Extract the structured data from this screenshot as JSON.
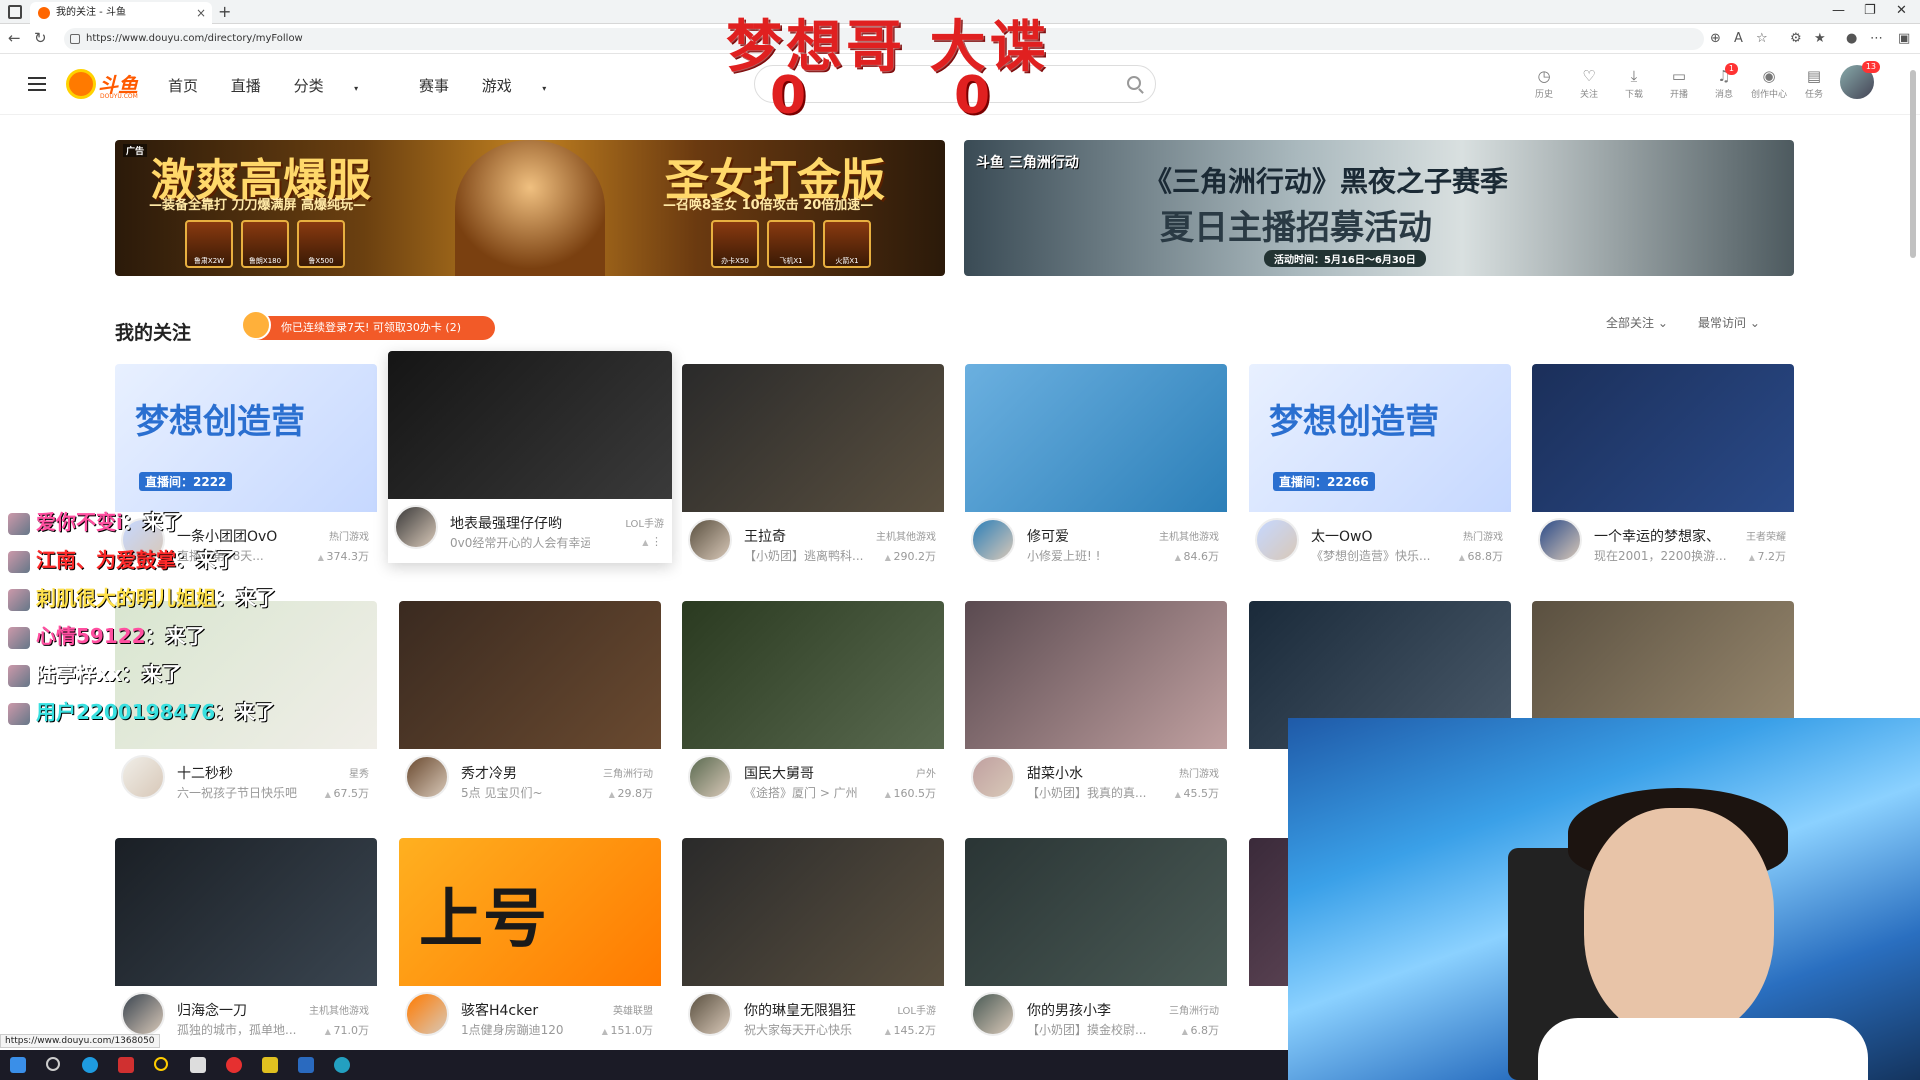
{
  "browser": {
    "tab_title": "我的关注 - 斗鱼",
    "url": "https://www.douyu.com/directory/myFollow",
    "status_url": "https://www.douyu.com/1368050"
  },
  "overlay": {
    "title": "梦想哥 大谍",
    "score_left": "0",
    "score_right": "0"
  },
  "site": {
    "logo_text": "斗鱼",
    "logo_sub": "DOUYU.COM",
    "nav": [
      "首页",
      "直播",
      "分类",
      "赛事",
      "游戏"
    ],
    "nav_dropdown": [
      "分类",
      "游戏"
    ],
    "header_icons": [
      {
        "label": "历史",
        "icon": "clock-icon",
        "glyph": "◷"
      },
      {
        "label": "关注",
        "icon": "heart-icon",
        "glyph": "♡"
      },
      {
        "label": "下载",
        "icon": "download-icon",
        "glyph": "⤓"
      },
      {
        "label": "开播",
        "icon": "camera-icon",
        "glyph": "▭"
      },
      {
        "label": "消息",
        "icon": "bell-icon",
        "glyph": "♫",
        "badge": "1"
      },
      {
        "label": "创作中心",
        "icon": "pin-icon",
        "glyph": "◉"
      },
      {
        "label": "任务",
        "icon": "task-icon",
        "glyph": "▤"
      }
    ],
    "avatar_badge": "13"
  },
  "banners": [
    {
      "title": "激爽高爆服",
      "title2": "圣女打金版",
      "sub": "—装备全靠打 刀刀爆满屏 高爆纯玩—",
      "sub2": "—召唤8圣女 10倍攻击 20倍加速—",
      "ad": "广告",
      "items": [
        "鲁肃X2W",
        "鲁朗X180",
        "鲁X500",
        "办卡X50",
        "飞机X1",
        "火箭X1"
      ]
    },
    {
      "title": "《三角洲行动》黑夜之子赛季",
      "title2": "夏日主播招募活动",
      "sub": "活动时间：5月16日～6月30日",
      "brand": "斗鱼 三角洲行动"
    }
  ],
  "section": {
    "title": "我的关注",
    "login_tip": "你已连续登录7天! 可领取30办卡 (2)",
    "filter_all": "全部关注",
    "filter_recent": "最常访问"
  },
  "cards": [
    {
      "name": "一条小团团OvO",
      "category": "热门游戏",
      "desc": "直播间第58天...",
      "hot": "374.3万",
      "thumb": [
        "#e8f0ff",
        "#c6d8ff"
      ],
      "thumb_text": "梦想创造营",
      "room": "直播间：2222"
    },
    {
      "name": "地表最强理仔仔哟",
      "category": "LOL手游",
      "desc": "0v0经常开心的人会有幸运!",
      "hot": "",
      "thumb": [
        "#151515",
        "#3a3a3a"
      ]
    },
    {
      "name": "王拉奇",
      "category": "主机其他游戏",
      "desc": "【小奶团】逃离鸭科...",
      "hot": "290.2万",
      "thumb": [
        "#2a2a2a",
        "#5a5040"
      ]
    },
    {
      "name": "修可爱",
      "category": "主机其他游戏",
      "desc": "小修爱上班! !",
      "hot": "84.6万",
      "thumb": [
        "#6bb0e0",
        "#2c7fb8"
      ]
    },
    {
      "name": "太一OwO",
      "category": "热门游戏",
      "desc": "《梦想创造营》快乐...",
      "hot": "68.8万",
      "thumb": [
        "#e8f0ff",
        "#c6d8ff"
      ],
      "thumb_text": "梦想创造营",
      "room": "直播间：22266"
    },
    {
      "name": "一个幸运的梦想家、",
      "category": "王者荣耀",
      "desc": "现在2001，2200换游...",
      "hot": "7.2万",
      "thumb": [
        "#1b2f5a",
        "#2a4a88"
      ]
    },
    {
      "name": "十二秒秒",
      "category": "星秀",
      "desc": "六一祝孩子节日快乐吧",
      "hot": "67.5万",
      "thumb": [
        "#d9e6d0",
        "#f0eee8"
      ]
    },
    {
      "name": "秀才冷男",
      "category": "三角洲行动",
      "desc": "5点 见宝贝们~",
      "hot": "29.8万",
      "thumb": [
        "#3a2a20",
        "#6a4a30"
      ]
    },
    {
      "name": "国民大舅哥",
      "category": "户外",
      "desc": "《途搭》厦门 > 广州",
      "hot": "160.5万",
      "thumb": [
        "#2a3a20",
        "#5a6a50"
      ]
    },
    {
      "name": "甜菜小水",
      "category": "热门游戏",
      "desc": "【小奶团】我真的真...",
      "hot": "45.5万",
      "thumb": [
        "#5a4a50",
        "#c0a0a0"
      ]
    },
    {
      "name": "",
      "category": "",
      "desc": "",
      "hot": "",
      "thumb": [
        "#1a2a3a",
        "#4a5a6a"
      ]
    },
    {
      "name": "",
      "category": "",
      "desc": "",
      "hot": "",
      "thumb": [
        "#5a5040",
        "#9a8a70"
      ]
    },
    {
      "name": "归海念一刀",
      "category": "主机其他游戏",
      "desc": "孤独的城市，孤单地...",
      "hot": "71.0万",
      "thumb": [
        "#1a1f25",
        "#3a4550"
      ]
    },
    {
      "name": "骇客H4cker",
      "category": "英雄联盟",
      "desc": "1点健身房蹦迪120",
      "hot": "151.0万",
      "thumb": [
        "#ffb020",
        "#ff7a00"
      ],
      "thumb_text": "上号"
    },
    {
      "name": "你的琳皇无限猖狂",
      "category": "LOL手游",
      "desc": "祝大家每天开心快乐",
      "hot": "145.2万",
      "thumb": [
        "#2a2a2a",
        "#5a5040"
      ]
    },
    {
      "name": "你的男孩小李",
      "category": "三角洲行动",
      "desc": "【小奶团】摸金校尉...",
      "hot": "6.8万",
      "thumb": [
        "#2a3535",
        "#4a5a55"
      ]
    },
    {
      "name": "",
      "category": "",
      "desc": "",
      "hot": "",
      "thumb": [
        "#3a2a3a",
        "#7a5a6a"
      ]
    }
  ],
  "chat": [
    {
      "user": "爱你不变i",
      "msg": "来了",
      "color": "#ff4fa0"
    },
    {
      "user": "江南、为爱鼓掌",
      "msg": "来了",
      "color": "#ff2a2a"
    },
    {
      "user": "刺肌很大的明儿姐姐",
      "msg": "来了",
      "color": "#ffe14a"
    },
    {
      "user": "心情59122",
      "msg": "来了",
      "color": "#ff4fa0"
    },
    {
      "user": "陆亭梓xx",
      "msg": "来了",
      "color": "#ffffff"
    },
    {
      "user": "用户2200198476",
      "msg": "来了",
      "color": "#39e0e0"
    }
  ]
}
